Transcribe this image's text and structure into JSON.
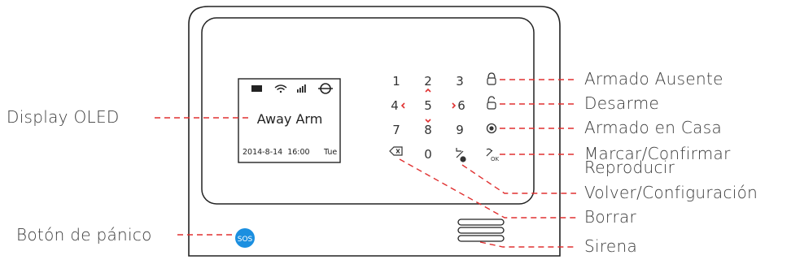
{
  "display": {
    "main_text": "Away Arm",
    "date_time": "2014-8-14  16:00",
    "weekday": "Tue"
  },
  "keypad": {
    "keys": [
      "1",
      "2",
      "3",
      "4",
      "5",
      "6",
      "7",
      "8",
      "9",
      "0"
    ]
  },
  "sos_label": "SOS",
  "labels": {
    "away_arm": "Armado Ausente",
    "disarm": "Desarme",
    "home_arm": "Armado en Casa",
    "dial_confirm": "Marcar/Confirmar",
    "playback": "Reproducir",
    "back_setup": "Volver/Configuración",
    "delete": "Borrar",
    "siren": "Sirena",
    "display_oled": "Display OLED",
    "panic_button": "Botón de pánico"
  },
  "colors": {
    "leader": "#e03030",
    "sos": "#1b8fe0",
    "outline": "#222222"
  }
}
